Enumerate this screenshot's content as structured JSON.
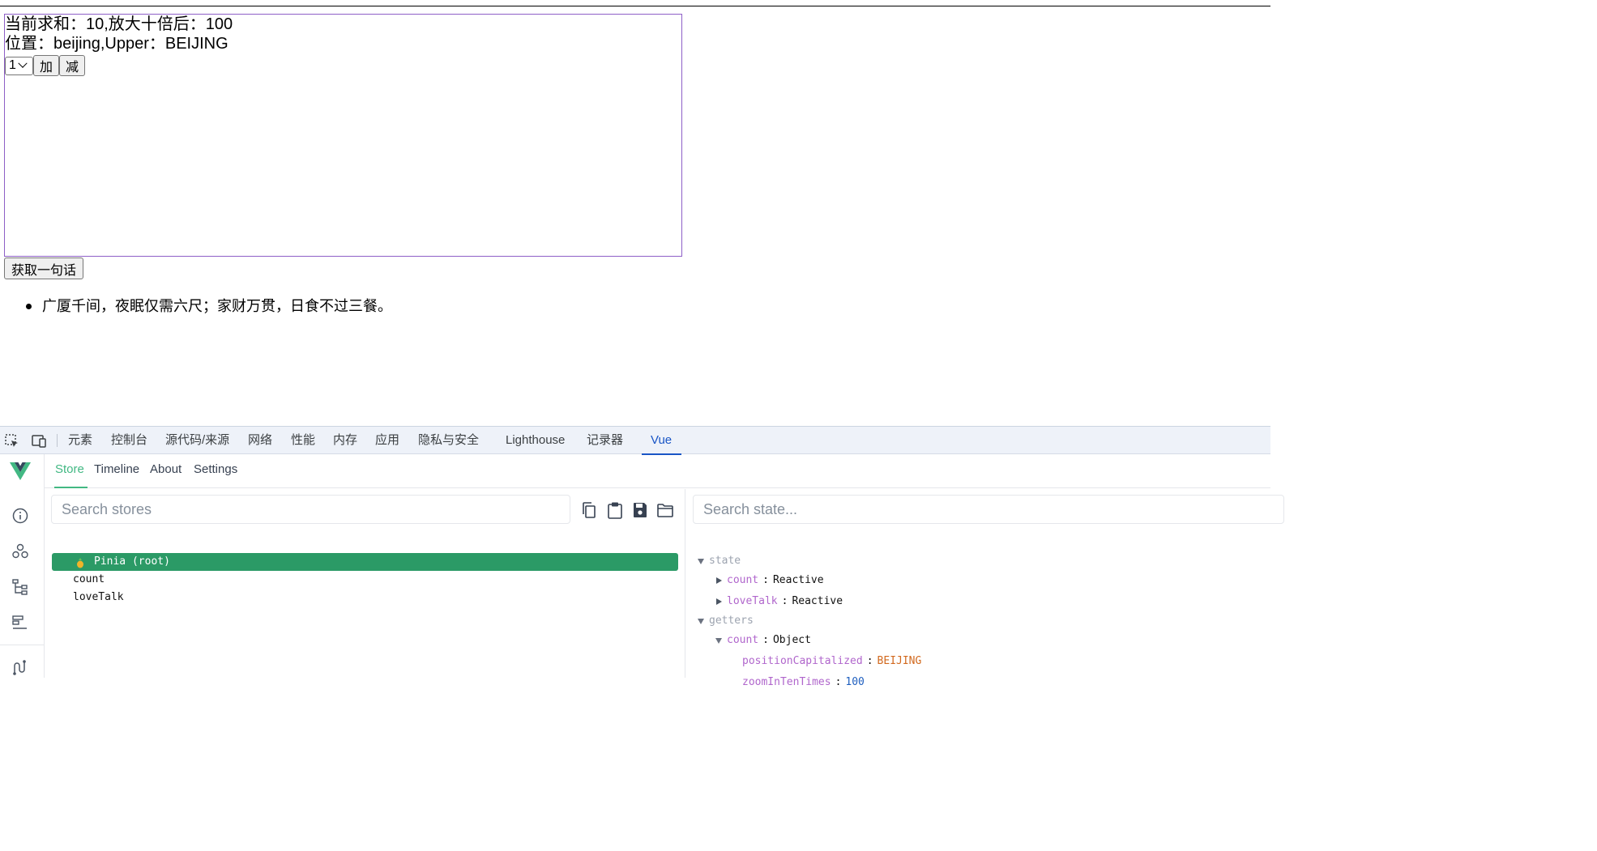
{
  "app": {
    "sum_line": "当前求和：10,放大十倍后：100",
    "position_line": "位置：beijing,Upper：BEIJING",
    "step_select_value": "1",
    "add_label": "加",
    "minus_label": "减",
    "get_talk_label": "获取一句话",
    "talks": [
      "广厦千间，夜眠仅需六尺；家财万贯，日食不过三餐。"
    ]
  },
  "devtools": {
    "tabs": [
      "元素",
      "控制台",
      "源代码/来源",
      "网络",
      "性能",
      "内存",
      "应用",
      "隐私与安全",
      "Lighthouse",
      "记录器",
      "Vue"
    ],
    "active_tab": "Vue"
  },
  "vue": {
    "nav": [
      "Store",
      "Timeline",
      "About",
      "Settings"
    ],
    "active_nav": "Store",
    "stores_search_placeholder": "Search stores",
    "stores": [
      {
        "label": "Pinia (root)",
        "selected": true
      },
      {
        "label": "count",
        "selected": false
      },
      {
        "label": "loveTalk",
        "selected": false
      }
    ],
    "state_search_placeholder": "Search state...",
    "state": {
      "state_label": "state",
      "state_entries": [
        {
          "key": "count",
          "value": "Reactive"
        },
        {
          "key": "loveTalk",
          "value": "Reactive"
        }
      ],
      "getters_label": "getters",
      "getter_entry": {
        "key": "count",
        "value": "Object"
      },
      "getter_children": [
        {
          "key": "positionCapitalized",
          "value": "BEIJING"
        },
        {
          "key": "zoomInTenTimes",
          "value": "100"
        }
      ]
    }
  },
  "colors": {
    "accent_vue": "#42b883",
    "selected_row": "#2b9a66",
    "devtools_active": "#1a56c6",
    "box_border": "#8e5fc7"
  }
}
